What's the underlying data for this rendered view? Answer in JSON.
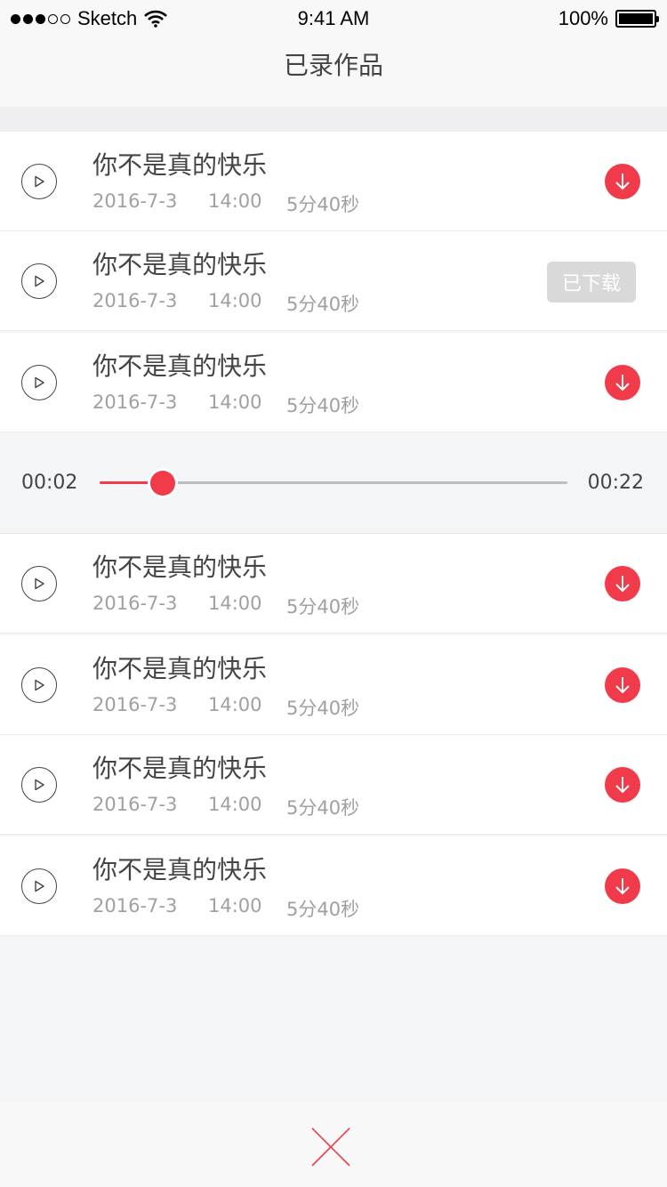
{
  "status_bar": {
    "carrier": "Sketch",
    "time": "9:41 AM",
    "battery": "100%",
    "signal_dots": [
      true,
      true,
      true,
      false,
      false
    ]
  },
  "nav": {
    "title": "已录作品"
  },
  "colors": {
    "accent": "#f23b4a",
    "downloaded_bg": "#d9d9d9"
  },
  "icons": {
    "play": "play-icon",
    "download": "download-arrow-icon",
    "close": "close-x-icon",
    "wifi": "wifi-icon",
    "battery": "battery-icon"
  },
  "recordings_top": [
    {
      "title": "你不是真的快乐",
      "date": "2016-7-3",
      "time": "14:00",
      "duration": "5分40秒",
      "status": "download"
    },
    {
      "title": "你不是真的快乐",
      "date": "2016-7-3",
      "time": "14:00",
      "duration": "5分40秒",
      "status": "downloaded",
      "status_label": "已下载"
    },
    {
      "title": "你不是真的快乐",
      "date": "2016-7-3",
      "time": "14:00",
      "duration": "5分40秒",
      "status": "download"
    }
  ],
  "player": {
    "current": "00:02",
    "total": "00:22",
    "progress": 0.135
  },
  "recordings_bottom": [
    {
      "title": "你不是真的快乐",
      "date": "2016-7-3",
      "time": "14:00",
      "duration": "5分40秒",
      "status": "download"
    },
    {
      "title": "你不是真的快乐",
      "date": "2016-7-3",
      "time": "14:00",
      "duration": "5分40秒",
      "status": "download"
    },
    {
      "title": "你不是真的快乐",
      "date": "2016-7-3",
      "time": "14:00",
      "duration": "5分40秒",
      "status": "download"
    },
    {
      "title": "你不是真的快乐",
      "date": "2016-7-3",
      "time": "14:00",
      "duration": "5分40秒",
      "status": "download"
    }
  ]
}
